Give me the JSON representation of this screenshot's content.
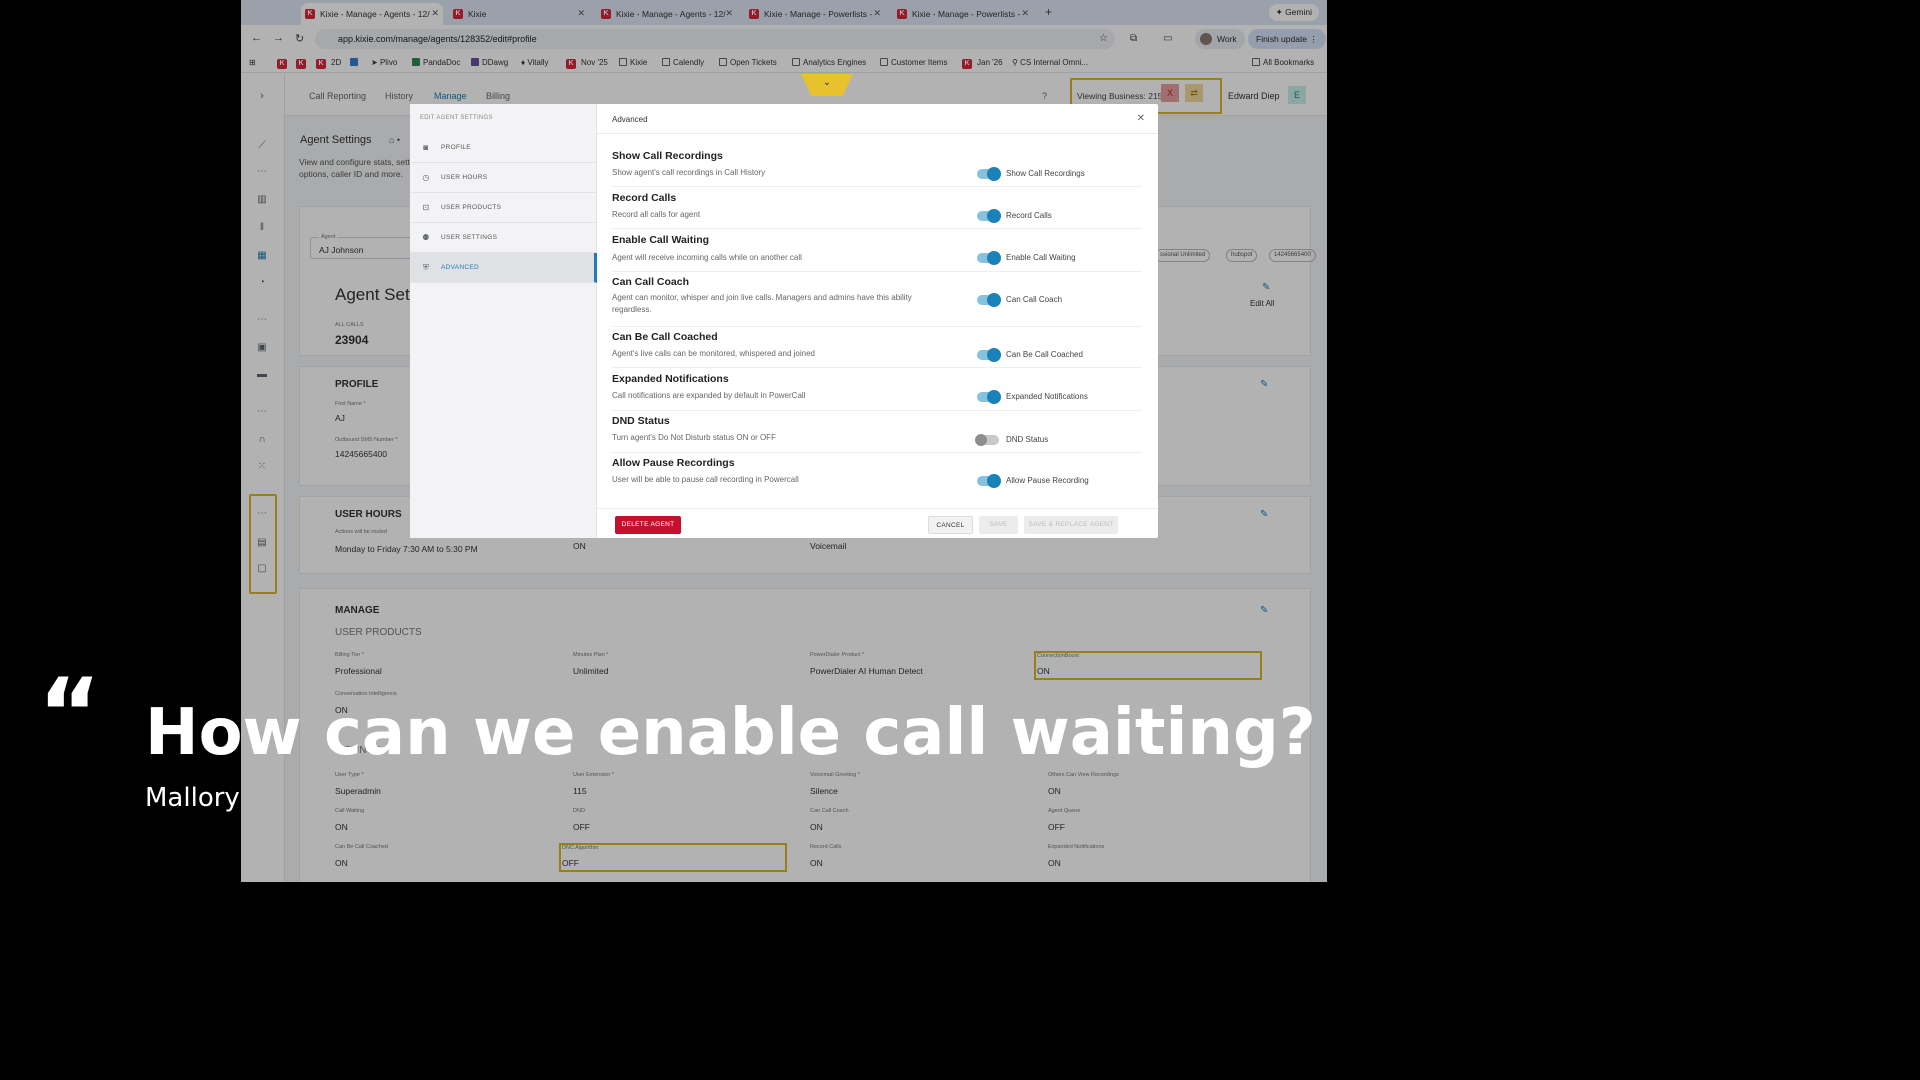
{
  "browser": {
    "tabs": [
      {
        "label": "Kixie - Manage - Agents - 12/"
      },
      {
        "label": "Kixie"
      },
      {
        "label": "Kixie - Manage - Agents - 12/"
      },
      {
        "label": "Kixie - Manage - Powerlists -"
      },
      {
        "label": "Kixie - Manage - Powerlists -"
      }
    ],
    "gemini_label": "Gemini",
    "url": "app.kixie.com/manage/agents/128352/edit#profile",
    "profile_label": "Work",
    "finish_update_label": "Finish update",
    "bookmarks": [
      "2D",
      "Plivo",
      "PandaDoc",
      "DDawg",
      "Vitally",
      "Nov '25",
      "Kixie",
      "Calendly",
      "Open Tickets",
      "Analytics Engines",
      "Customer Items",
      "Jan '26",
      "CS Internal Omni..."
    ],
    "all_bookmarks_label": "All Bookmarks"
  },
  "topnav": {
    "items": [
      "Call Reporting",
      "History",
      "Manage",
      "Billing"
    ],
    "viewing_business": "Viewing Business: 21594",
    "x_label": "X",
    "user_name": "Edward Diep",
    "user_initial": "E"
  },
  "page": {
    "agent_settings_title": "Agent Settings",
    "description_line1": "View and configure stats, sett",
    "description_line2": "options, caller ID and more.",
    "agent_label": "Agent",
    "agent_value": "AJ Johnson",
    "chips": [
      "ssional Unlimited",
      "hubspot",
      "14245665400"
    ],
    "edit_all_label": "Edit All",
    "agent_heading": "Agent Set",
    "all_calls_label": "ALL CALLS",
    "all_calls_value": "23904",
    "profile_heading": "PROFILE",
    "first_name_label": "First Name *",
    "first_name_value": "AJ",
    "outbound_label": "Outbound SMS Number *",
    "outbound_value": "14245665400",
    "user_hours_heading": "USER HOURS",
    "actions_label": "Actions will be routed",
    "hours_value": "Monday to Friday 7:30 AM to 5:30 PM",
    "hours_on": "ON",
    "voicemail": "Voicemail",
    "manage_heading": "MANAGE",
    "user_products_heading": "USER PRODUCTS",
    "billing_tier_label": "Billing Tier *",
    "billing_tier_value": "Professional",
    "minutes_plan_label": "Minutes Plan *",
    "minutes_plan_value": "Unlimited",
    "powerdialer_label": "PowerDialer Product *",
    "powerdialer_value": "PowerDialer AI Human Detect",
    "connectionboost_label": "ConnectionBoost",
    "connectionboost_value": "ON",
    "conversation_label": "Conversation Intelligence",
    "conversation_value": "ON",
    "settings_partial": "S TTINGS",
    "user_type_label": "User Type *",
    "user_type_value": "Superadmin",
    "user_extension_label": "User Extension *",
    "user_extension_value": "115",
    "voicemail_greeting_label": "Voicemail Greeting *",
    "voicemail_greeting_value": "Silence",
    "others_view_label": "Others Can View Recordings",
    "others_view_value": "ON",
    "call_waiting_label": "Call Waiting",
    "call_waiting_value": "ON",
    "dnd_label": "DND",
    "dnd_value": "OFF",
    "can_call_coach_label": "Can Call Coach",
    "can_call_coach_value": "ON",
    "agent_queue_label": "Agent Queue",
    "agent_queue_value": "OFF",
    "can_be_coached_label": "Can Be Call Coached",
    "can_be_coached_value": "ON",
    "dnc_label": "DNC Algorithm",
    "dnc_value": "OFF",
    "record_calls_label": "Record Calls",
    "record_calls_value": "ON",
    "expanded_label": "Expanded Notifications",
    "expanded_value": "ON"
  },
  "modal": {
    "sidebar_title": "EDIT AGENT SETTINGS",
    "nav": [
      {
        "label": "PROFILE",
        "icon": "user-icon"
      },
      {
        "label": "USER HOURS",
        "icon": "clock-icon"
      },
      {
        "label": "USER PRODUCTS",
        "icon": "box-icon"
      },
      {
        "label": "USER SETTINGS",
        "icon": "user-gear-icon"
      },
      {
        "label": "ADVANCED",
        "icon": "shield-icon"
      }
    ],
    "header": "Advanced",
    "settings": [
      {
        "title": "Show Call Recordings",
        "desc": "Show agent's call recordings in Call History",
        "toggle_label": "Show Call Recordings",
        "on": true
      },
      {
        "title": "Record Calls",
        "desc": "Record all calls for agent",
        "toggle_label": "Record Calls",
        "on": true
      },
      {
        "title": "Enable Call Waiting",
        "desc": "Agent will receive incoming calls while on another call",
        "toggle_label": "Enable Call Waiting",
        "on": true
      },
      {
        "title": "Can Call Coach",
        "desc": "Agent can monitor, whisper and join live calls. Managers and admins have this ability regardless.",
        "toggle_label": "Can Call Coach",
        "on": true
      },
      {
        "title": "Can Be Call Coached",
        "desc": "Agent's live calls can be monitored, whispered and joined",
        "toggle_label": "Can Be Call Coached",
        "on": true
      },
      {
        "title": "Expanded Notifications",
        "desc": "Call notifications are expanded by default in PowerCall",
        "toggle_label": "Expanded Notifications",
        "on": true
      },
      {
        "title": "DND Status",
        "desc": "Turn agent's Do Not Disturb status ON or OFF",
        "toggle_label": "DND Status",
        "on": false
      },
      {
        "title": "Allow Pause Recordings",
        "desc": "User will be able to pause call recording in Powercall",
        "toggle_label": "Allow Pause Recording",
        "on": true
      }
    ],
    "delete_label": "DELETE AGENT",
    "cancel_label": "CANCEL",
    "save_label": "SAVE",
    "save_replace_label": "SAVE & REPLACE AGENT"
  },
  "caption": {
    "quote_mark": "“",
    "question": "How can we enable call waiting?",
    "author": "Mallory"
  },
  "colors": {
    "accent": "#1a7fb5",
    "danger": "#c8102e",
    "highlight": "#d8b726"
  }
}
